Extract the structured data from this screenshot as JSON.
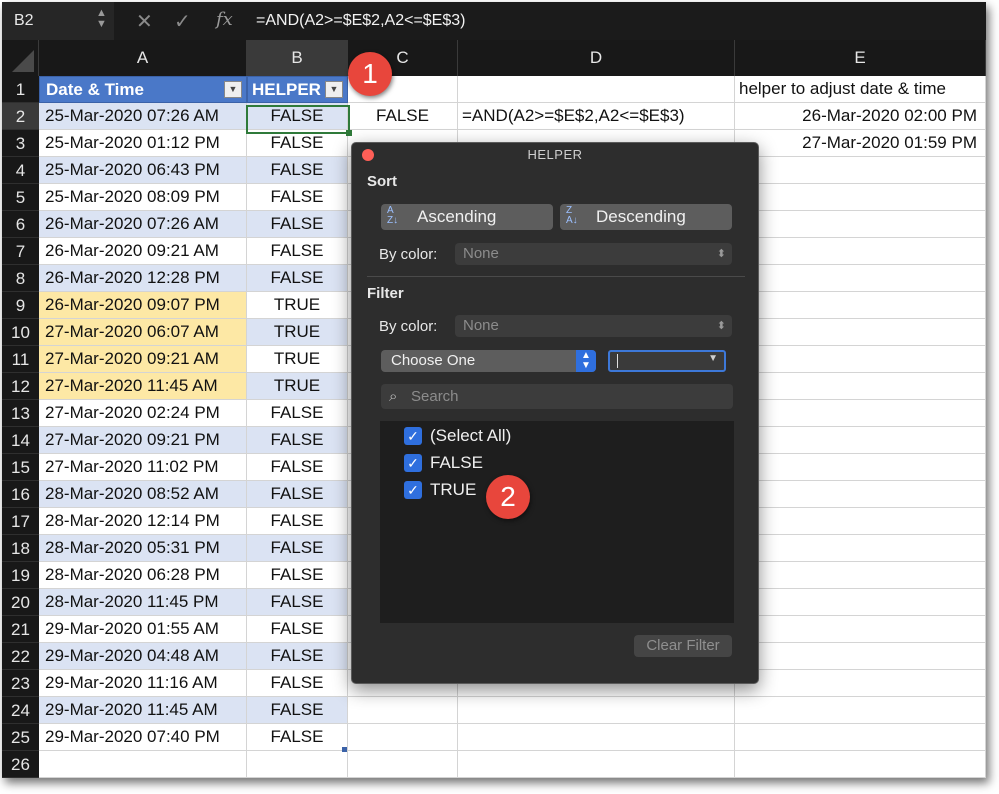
{
  "formula_bar": {
    "name_box": "B2",
    "cancel_icon": "close-icon",
    "enter_icon": "checkmark-icon",
    "fx_label": "fx",
    "formula": "=AND(A2>=$E$2,A2<=$E$3)"
  },
  "columns": [
    "A",
    "B",
    "C",
    "D",
    "E"
  ],
  "rows": [
    "1",
    "2",
    "3",
    "4",
    "5",
    "6",
    "7",
    "8",
    "9",
    "10",
    "11",
    "12",
    "13",
    "14",
    "15",
    "16",
    "17",
    "18",
    "19",
    "20",
    "21",
    "22",
    "23",
    "24",
    "25",
    "26"
  ],
  "header_row": {
    "a": "Date & Time",
    "b": "HELPER",
    "e": "helper to adjust date & time"
  },
  "cells": {
    "c2": "FALSE",
    "d2": "=AND(A2>=$E$2,A2<=$E$3)",
    "e2": "26-Mar-2020 02:00 PM",
    "e3": "27-Mar-2020 01:59 PM"
  },
  "data_rows": [
    {
      "a": "25-Mar-2020 07:26 AM",
      "b": "FALSE"
    },
    {
      "a": "25-Mar-2020 01:12 PM",
      "b": "FALSE"
    },
    {
      "a": "25-Mar-2020 06:43 PM",
      "b": "FALSE"
    },
    {
      "a": "25-Mar-2020 08:09 PM",
      "b": "FALSE"
    },
    {
      "a": "26-Mar-2020 07:26 AM",
      "b": "FALSE"
    },
    {
      "a": "26-Mar-2020 09:21 AM",
      "b": "FALSE"
    },
    {
      "a": "26-Mar-2020 12:28 PM",
      "b": "FALSE"
    },
    {
      "a": "26-Mar-2020 09:07 PM",
      "b": "TRUE"
    },
    {
      "a": "27-Mar-2020 06:07 AM",
      "b": "TRUE"
    },
    {
      "a": "27-Mar-2020 09:21 AM",
      "b": "TRUE"
    },
    {
      "a": "27-Mar-2020 11:45 AM",
      "b": "TRUE"
    },
    {
      "a": "27-Mar-2020 02:24 PM",
      "b": "FALSE"
    },
    {
      "a": "27-Mar-2020 09:21 PM",
      "b": "FALSE"
    },
    {
      "a": "27-Mar-2020 11:02 PM",
      "b": "FALSE"
    },
    {
      "a": "28-Mar-2020 08:52 AM",
      "b": "FALSE"
    },
    {
      "a": "28-Mar-2020 12:14 PM",
      "b": "FALSE"
    },
    {
      "a": "28-Mar-2020 05:31 PM",
      "b": "FALSE"
    },
    {
      "a": "28-Mar-2020 06:28 PM",
      "b": "FALSE"
    },
    {
      "a": "28-Mar-2020 11:45 PM",
      "b": "FALSE"
    },
    {
      "a": "29-Mar-2020 01:55 AM",
      "b": "FALSE"
    },
    {
      "a": "29-Mar-2020 04:48 AM",
      "b": "FALSE"
    },
    {
      "a": "29-Mar-2020 11:16 AM",
      "b": "FALSE"
    },
    {
      "a": "29-Mar-2020 11:45 AM",
      "b": "FALSE"
    },
    {
      "a": "29-Mar-2020 07:40 PM",
      "b": "FALSE"
    }
  ],
  "highlight_color": "#fde8a5",
  "band_color": "#dbe3f3",
  "header_color": "#4a78c8",
  "callouts": [
    "1",
    "2"
  ],
  "popup": {
    "title": "HELPER",
    "sort_heading": "Sort",
    "ascending_label": "Ascending",
    "descending_label": "Descending",
    "sort_by_color_label": "By color:",
    "sort_by_color_value": "None",
    "filter_heading": "Filter",
    "filter_by_color_label": "By color:",
    "filter_by_color_value": "None",
    "condition_select": "Choose One",
    "search_placeholder": "Search",
    "list_items": [
      {
        "label": "(Select All)",
        "checked": true
      },
      {
        "label": "FALSE",
        "checked": true
      },
      {
        "label": "TRUE",
        "checked": true
      }
    ],
    "clear_filter_label": "Clear Filter"
  }
}
